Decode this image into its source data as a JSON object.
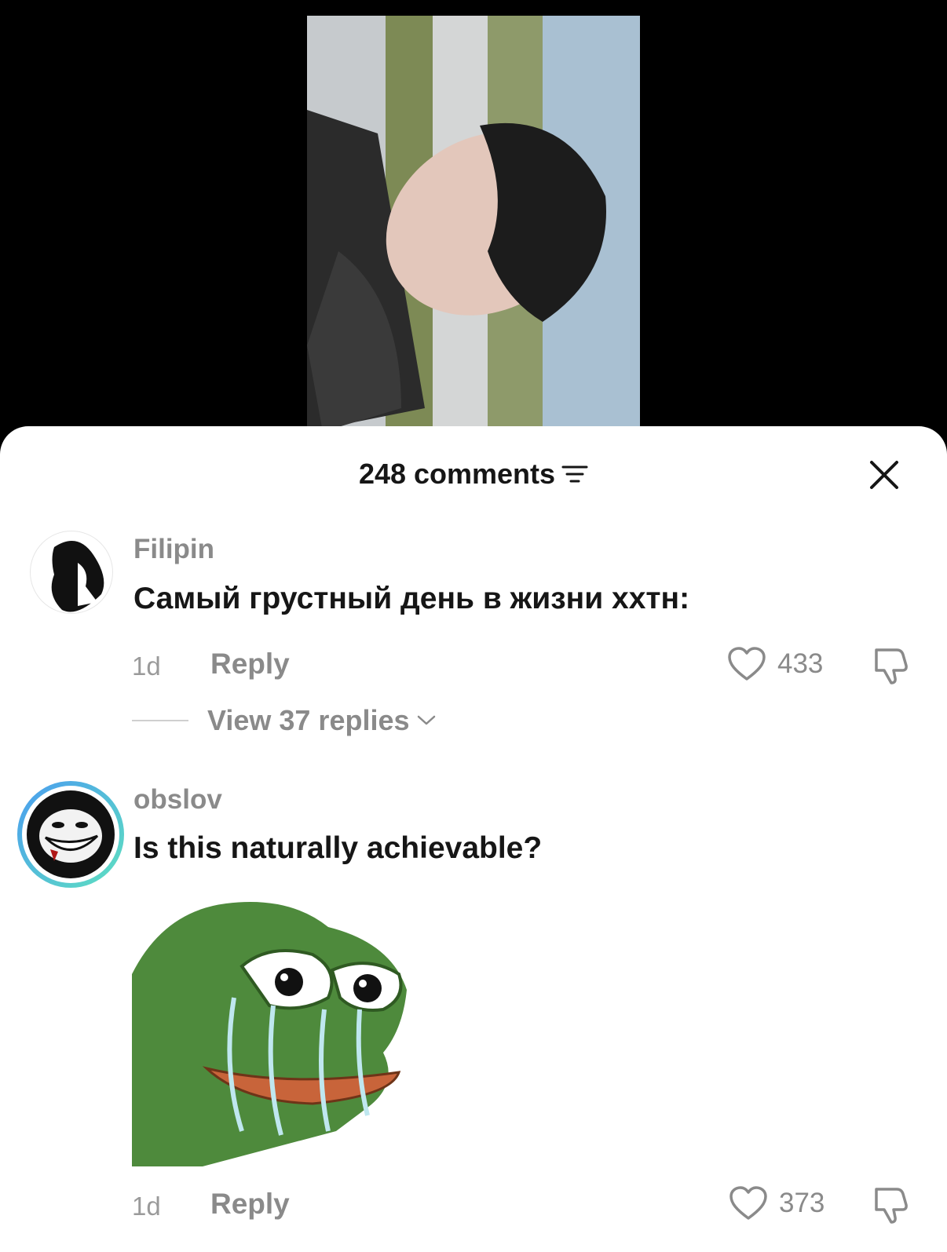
{
  "header": {
    "comment_count_label": "248 comments"
  },
  "comments": [
    {
      "username": "Filipin",
      "text": "Самый грустный день в жизни xxтн:",
      "time": "1d",
      "reply_label": "Reply",
      "likes": "433",
      "view_replies_label": "View 37 replies"
    },
    {
      "username": "obslov",
      "text": "Is this naturally achievable?",
      "time": "1d",
      "reply_label": "Reply",
      "likes": "373"
    }
  ],
  "colors": {
    "sheet_bg": "#ffffff",
    "primary_text": "#161616",
    "secondary_text": "#8a8a8a",
    "avatar_ring_start": "#4a9cf0",
    "avatar_ring_end": "#5ee0c0"
  },
  "icons": [
    "filter-icon",
    "close-icon",
    "heart-icon",
    "dislike-icon",
    "chevron-down-icon"
  ]
}
